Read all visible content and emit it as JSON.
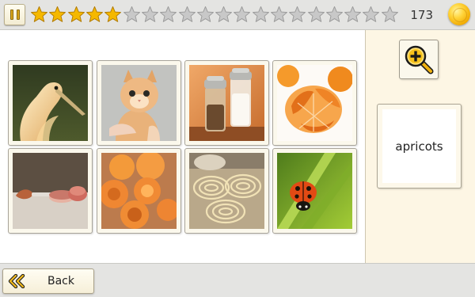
{
  "toolbar": {
    "pause": "pause-icon",
    "stars_total": 20,
    "stars_filled": 5,
    "star_color": "#f5b800",
    "star_empty_color": "#c8c8c8",
    "score": "173",
    "coin": "coin-icon"
  },
  "grid": {
    "cards": [
      {
        "subject": "heron"
      },
      {
        "subject": "kitten"
      },
      {
        "subject": "salt-and-pepper-shakers"
      },
      {
        "subject": "mandarin-orange"
      },
      {
        "subject": "makeup-brush"
      },
      {
        "subject": "apricots"
      },
      {
        "subject": "pasta-nests"
      },
      {
        "subject": "ladybug"
      }
    ]
  },
  "side": {
    "zoom_icon": "zoom-in-icon",
    "word": "apricots"
  },
  "footer": {
    "back_label": "Back",
    "back_icon": "double-chevron-left-icon"
  }
}
